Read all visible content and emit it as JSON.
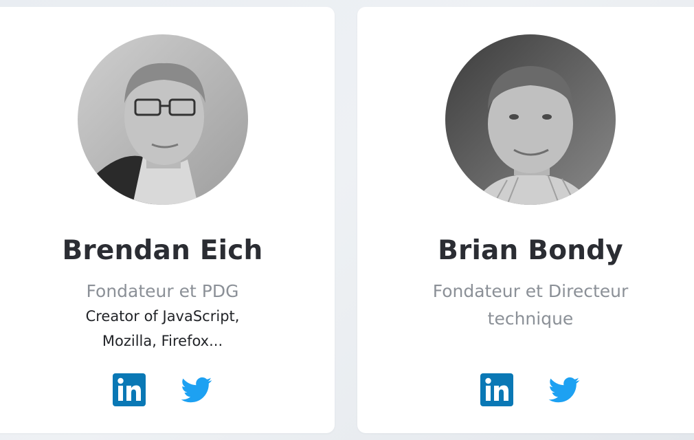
{
  "team": [
    {
      "name": "Brendan Eich",
      "role": "Fondateur et PDG",
      "description_line1": "Creator of JavaScript,",
      "description_line2": "Mozilla, Firefox...",
      "avatar_icon": "person-photo-grayscale",
      "socials": [
        "linkedin-icon",
        "twitter-icon"
      ]
    },
    {
      "name": "Brian Bondy",
      "role_line1": "Fondateur et Directeur",
      "role_line2": "technique",
      "avatar_icon": "person-photo-grayscale",
      "socials": [
        "linkedin-icon",
        "twitter-icon"
      ]
    }
  ],
  "colors": {
    "linkedin": "#0a78b5",
    "twitter": "#1da1f2",
    "name": "#2b2d33",
    "role": "#8b9097"
  }
}
